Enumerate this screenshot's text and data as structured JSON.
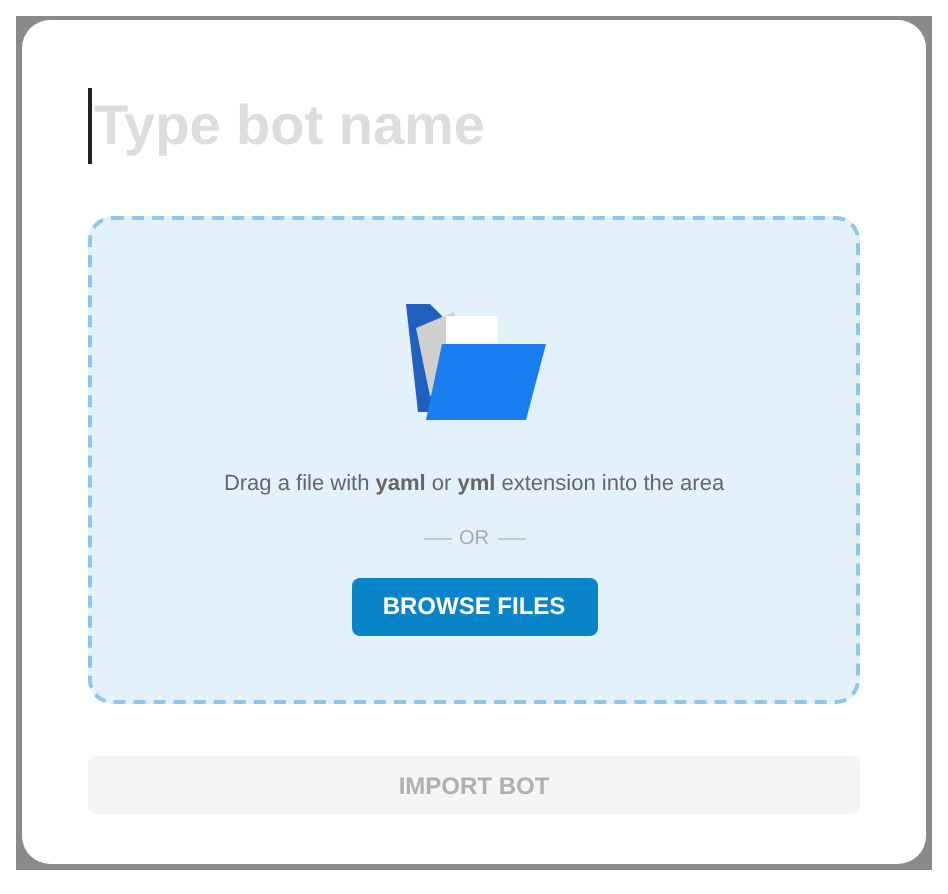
{
  "name_field": {
    "placeholder": "Type bot name"
  },
  "dropzone": {
    "instructions": "Drag a file with **yaml** or **yml** extension into the area",
    "separator": "OR",
    "browse_button": "BROWSE FILES"
  },
  "import_button": {
    "label": "IMPORT BOT",
    "disabled": true
  }
}
